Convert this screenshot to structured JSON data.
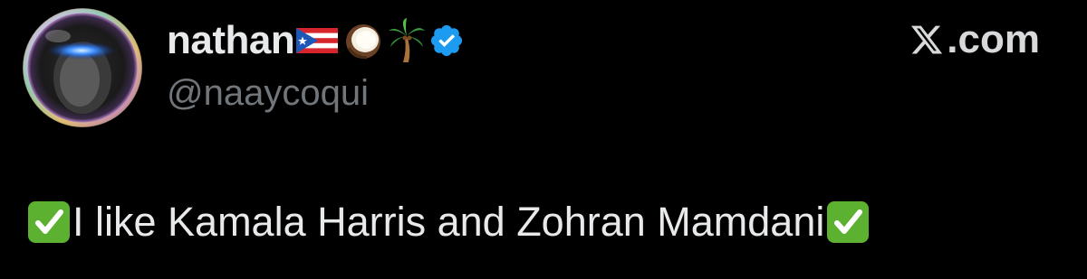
{
  "author": {
    "display_name": "nathan",
    "handle": "@naaycoqui",
    "name_emojis": [
      "puerto-rico-flag",
      "coconut",
      "palm-tree"
    ],
    "verified": true
  },
  "site": {
    "label": ".com",
    "logo": "x-logo-icon"
  },
  "tweet": {
    "prefix_emoji": "check-mark-button",
    "text": "I like Kamala Harris and Zohran Mamdani",
    "suffix_emoji": "check-mark-button"
  },
  "colors": {
    "background": "#000000",
    "primary_text": "#e7e9ea",
    "secondary_text": "#71767b",
    "verified_badge": "#1d9bf0",
    "check_emoji": "#5cb130"
  }
}
